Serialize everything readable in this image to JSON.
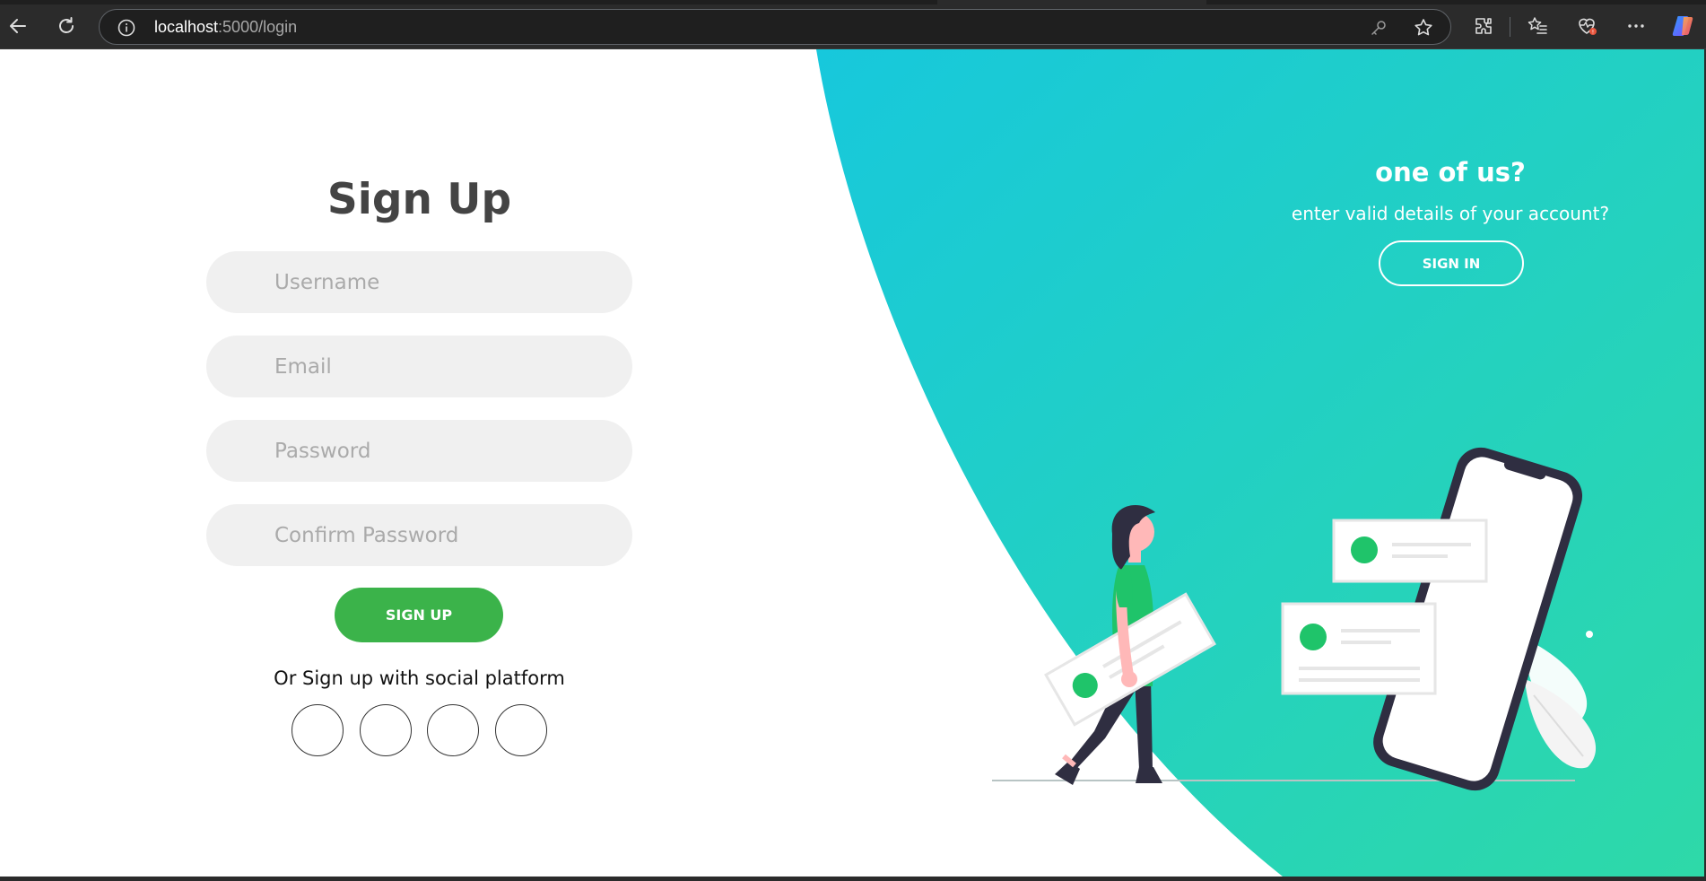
{
  "browser": {
    "url_host": "localhost",
    "url_rest": ":5000/login",
    "icons": [
      "back-arrow-icon",
      "reload-icon",
      "info-icon",
      "key-icon",
      "star-icon",
      "extensions-icon",
      "favorites-icon",
      "health-icon",
      "more-icon",
      "copilot-icon"
    ]
  },
  "signup": {
    "title": "Sign Up",
    "username_placeholder": "Username",
    "email_placeholder": "Email",
    "password_placeholder": "Password",
    "confirm_placeholder": "Confirm Password",
    "submit_label": "SIGN UP",
    "social_text": "Or Sign up with social platform",
    "social_icons": [
      "social-icon-1",
      "social-icon-2",
      "social-icon-3",
      "social-icon-4"
    ]
  },
  "panel": {
    "heading": "one of us?",
    "text": "enter valid details of your account?",
    "signin_label": "SIGN IN"
  },
  "colors": {
    "accent_green": "#3bb34a",
    "teal_start": "#17c8dc",
    "teal_end": "#2ed9a8",
    "input_bg": "#f0f0f0",
    "title_color": "#444444"
  }
}
